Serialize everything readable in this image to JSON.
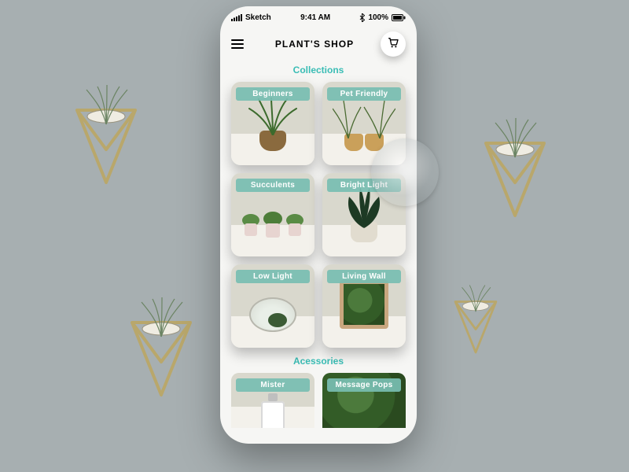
{
  "status": {
    "carrier": "Sketch",
    "time": "9:41 AM",
    "battery": "100%"
  },
  "header": {
    "title": "PLANT'S  SHOP"
  },
  "sections": {
    "collections_title": "Collections",
    "accessories_title": "Acessories"
  },
  "collections": [
    {
      "label": "Beginners"
    },
    {
      "label": "Pet Friendly"
    },
    {
      "label": "Succulents"
    },
    {
      "label": "Bright Light"
    },
    {
      "label": "Low Light"
    },
    {
      "label": "Living Wall"
    }
  ],
  "accessories": [
    {
      "label": "Mister"
    },
    {
      "label": "Message Pops"
    }
  ],
  "colors": {
    "accent": "#3abdb5",
    "card_label_bg": "#78beb2"
  }
}
